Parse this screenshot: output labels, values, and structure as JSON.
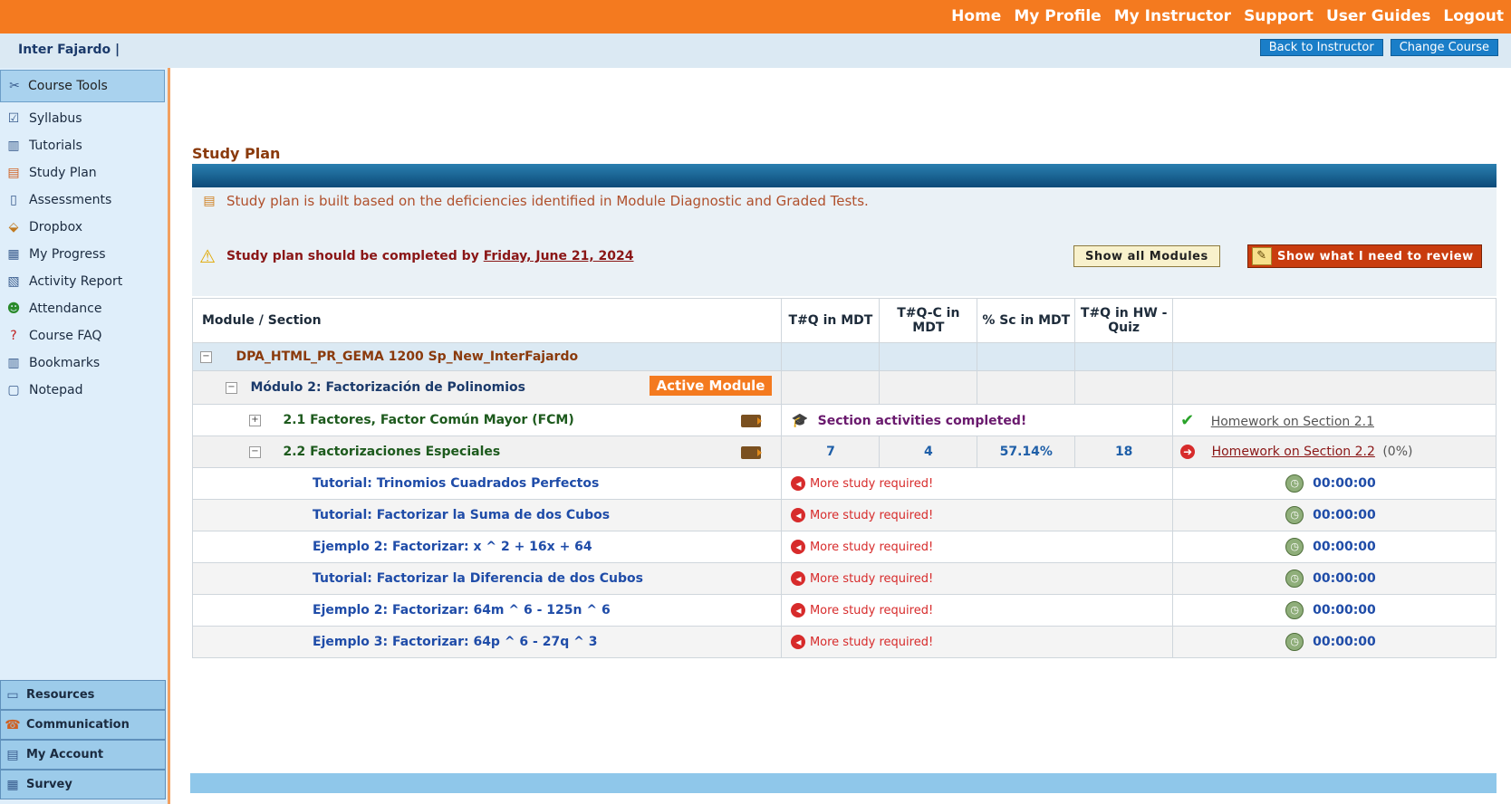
{
  "topnav": [
    "Home",
    "My Profile",
    "My Instructor",
    "Support",
    "User Guides",
    "Logout"
  ],
  "org": "Inter Fajardo |",
  "subbuttons": [
    "Back to Instructor",
    "Change Course"
  ],
  "sidebar": {
    "header": "Course Tools",
    "items": [
      {
        "label": "Syllabus",
        "icon": "syllabus-icon"
      },
      {
        "label": "Tutorials",
        "icon": "tutorials-icon"
      },
      {
        "label": "Study Plan",
        "icon": "study-plan-icon"
      },
      {
        "label": "Assessments",
        "icon": "assessments-icon"
      },
      {
        "label": "Dropbox",
        "icon": "dropbox-icon"
      },
      {
        "label": "My Progress",
        "icon": "progress-icon"
      },
      {
        "label": "Activity Report",
        "icon": "report-icon"
      },
      {
        "label": "Attendance",
        "icon": "attendance-icon"
      },
      {
        "label": "Course FAQ",
        "icon": "faq-icon"
      },
      {
        "label": "Bookmarks",
        "icon": "bookmarks-icon"
      },
      {
        "label": "Notepad",
        "icon": "notepad-icon"
      }
    ],
    "bottom": [
      "Resources",
      "Communication",
      "My Account",
      "Survey"
    ]
  },
  "page": {
    "title": "Study Plan",
    "info": "Study plan is built based on the deficiencies identified in Module Diagnostic and Graded Tests.",
    "warn_prefix": "Study plan should be completed by",
    "warn_date": "Friday, June 21, 2024",
    "show_all": "Show all Modules",
    "show_review": "Show what I need to review"
  },
  "table": {
    "headers": [
      "Module / Section",
      "T#Q in MDT",
      "T#Q-C in MDT",
      "% Sc in MDT",
      "T#Q in HW - Quiz",
      ""
    ],
    "root": "DPA_HTML_PR_GEMA 1200 Sp_New_InterFajardo",
    "module": "Módulo 2: Factorización de Polinomios",
    "active_label": "Active Module",
    "sec1": {
      "name": "2.1 Factores, Factor Común Mayor (FCM)",
      "status": "Section activities completed!",
      "homework": "Homework on Section 2.1"
    },
    "sec2": {
      "name": "2.2 Factorizaciones Especiales",
      "tq": "7",
      "tqc": "4",
      "sc": "57.14%",
      "hw": "18",
      "homework": "Homework on Section 2.2",
      "hw_pct": "(0%)"
    },
    "items": [
      {
        "name": "Tutorial: Trinomios Cuadrados Perfectos",
        "status": "More study required!",
        "time": "00:00:00"
      },
      {
        "name": "Tutorial: Factorizar la Suma de dos Cubos",
        "status": "More study required!",
        "time": "00:00:00"
      },
      {
        "name": "Ejemplo 2: Factorizar: x ^ 2 + 16x + 64",
        "status": "More study required!",
        "time": "00:00:00"
      },
      {
        "name": "Tutorial: Factorizar la Diferencia de dos Cubos",
        "status": "More study required!",
        "time": "00:00:00"
      },
      {
        "name": "Ejemplo 2: Factorizar: 64m ^ 6 - 125n ^ 6",
        "status": "More study required!",
        "time": "00:00:00"
      },
      {
        "name": "Ejemplo 3: Factorizar: 64p ^ 6 - 27q ^ 3",
        "status": "More study required!",
        "time": "00:00:00"
      }
    ]
  },
  "colors": {
    "orange": "#f47a1f",
    "blue": "#1a7ec8",
    "dark_red": "#8a1616"
  }
}
